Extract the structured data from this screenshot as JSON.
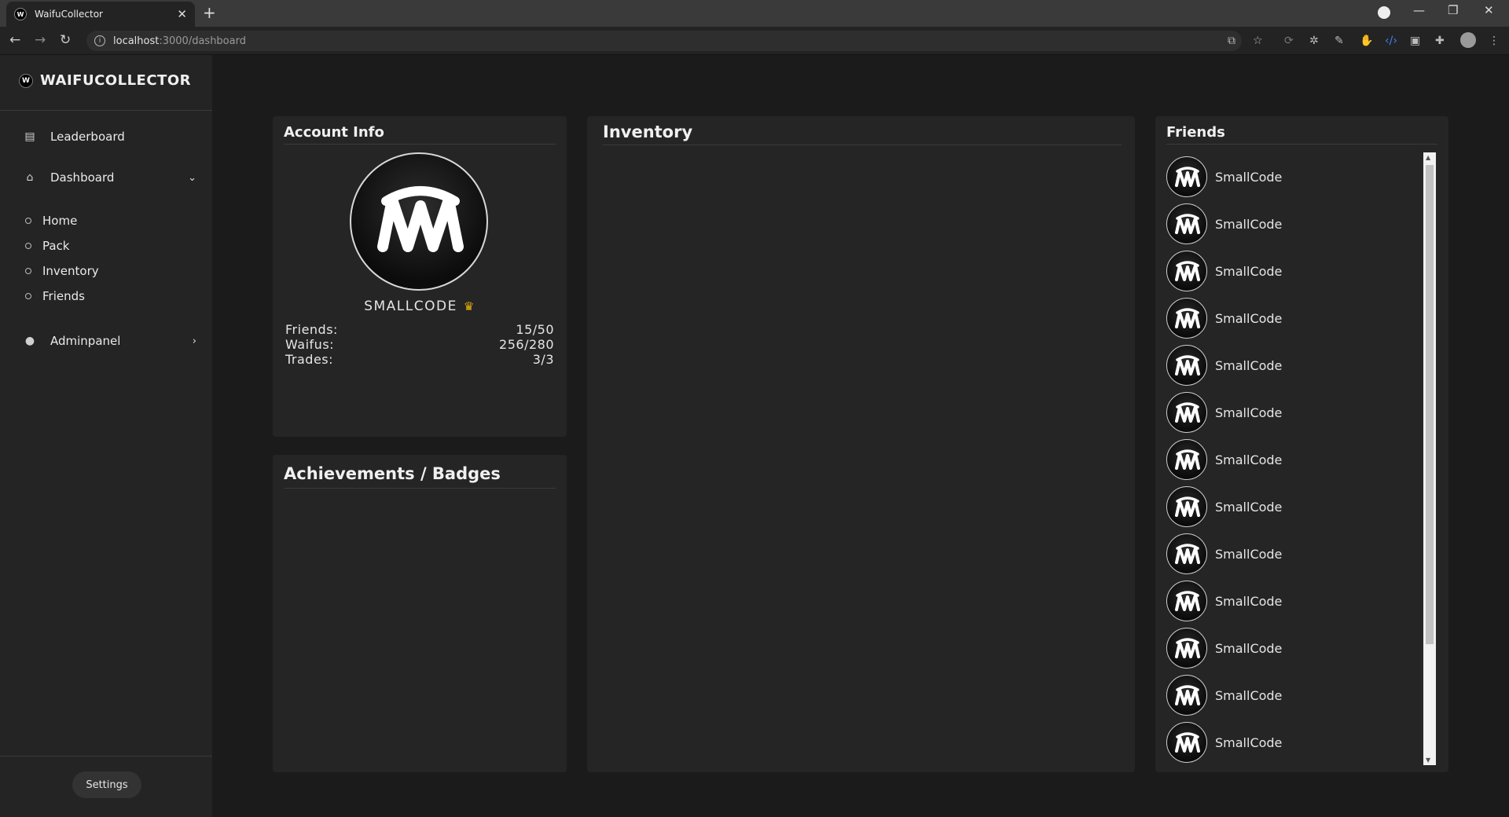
{
  "browser": {
    "tab_title": "WaifuCollector",
    "url_host": "localhost",
    "url_path": ":3000/dashboard"
  },
  "sidebar": {
    "brand": "WAIFUCOLLECTOR",
    "items": [
      {
        "label": "Leaderboard",
        "icon": "clipboard-icon"
      },
      {
        "label": "Dashboard",
        "icon": "home-icon"
      },
      {
        "label": "Adminpanel",
        "icon": "user-icon"
      }
    ],
    "sub_items": [
      "Home",
      "Pack",
      "Inventory",
      "Friends"
    ],
    "settings_label": "Settings"
  },
  "account": {
    "title": "Account Info",
    "username": "SMALLCODE",
    "stats": [
      {
        "label": "Friends:",
        "value": "15/50"
      },
      {
        "label": "Waifus:",
        "value": "256/280"
      },
      {
        "label": "Trades:",
        "value": "3/3"
      }
    ]
  },
  "achievements": {
    "title": "Achievements / Badges"
  },
  "inventory": {
    "title": "Inventory"
  },
  "friends": {
    "title": "Friends",
    "list": [
      "SmallCode",
      "SmallCode",
      "SmallCode",
      "SmallCode",
      "SmallCode",
      "SmallCode",
      "SmallCode",
      "SmallCode",
      "SmallCode",
      "SmallCode",
      "SmallCode",
      "SmallCode",
      "SmallCode"
    ]
  },
  "colors": {
    "accent_crown": "#e8b10d",
    "background": "#1b1b1b",
    "card": "#252525",
    "sidebar": "#242424"
  }
}
